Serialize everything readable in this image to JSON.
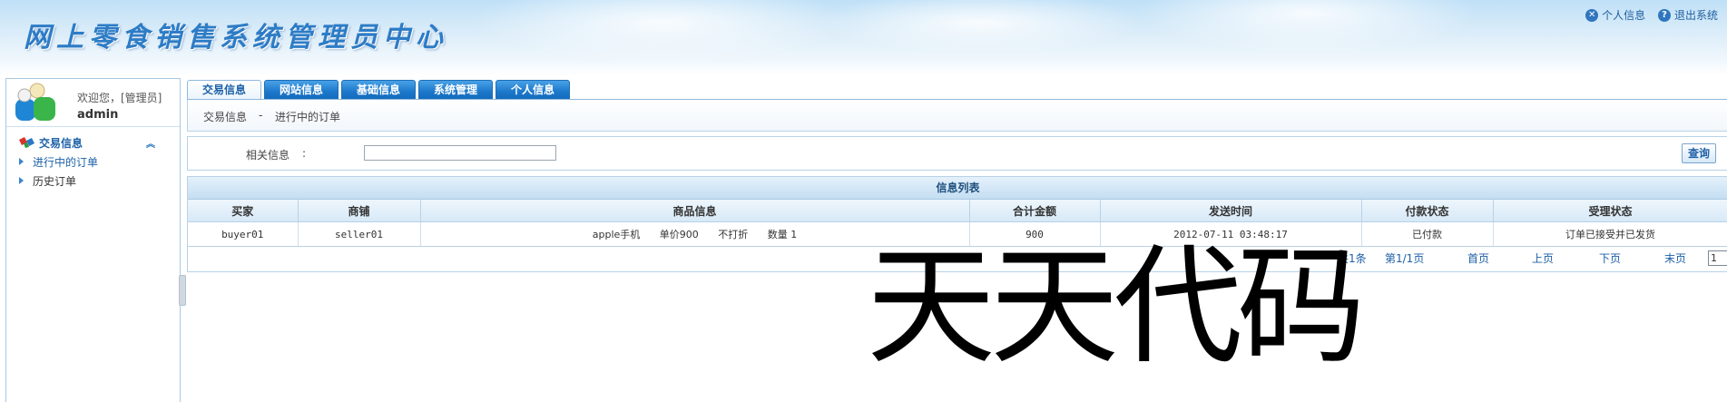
{
  "header": {
    "title": "网上零食销售系统管理员中心",
    "links": [
      {
        "label": "个人信息",
        "icon": "close-circle-icon"
      },
      {
        "label": "退出系统",
        "icon": "help-circle-icon"
      }
    ]
  },
  "user": {
    "welcome": "欢迎您，[管理员]",
    "name": "admin"
  },
  "sidebar": {
    "section": {
      "label": "交易信息",
      "collapse_icon": "double-chevron-up-icon"
    },
    "items": [
      {
        "label": "进行中的订单",
        "active": true
      },
      {
        "label": "历史订单",
        "active": false
      }
    ]
  },
  "tabs": [
    {
      "label": "交易信息",
      "active": true
    },
    {
      "label": "网站信息",
      "active": false
    },
    {
      "label": "基础信息",
      "active": false
    },
    {
      "label": "系统管理",
      "active": false
    },
    {
      "label": "个人信息",
      "active": false
    }
  ],
  "breadcrumb": {
    "section": "交易信息",
    "separator": "-",
    "page": "进行中的订单"
  },
  "search": {
    "label": "相关信息",
    "colon": ":",
    "value": "",
    "button": "查询"
  },
  "table": {
    "title": "信息列表",
    "columns": [
      "买家",
      "商铺",
      "商品信息",
      "合计金额",
      "发送时间",
      "付款状态",
      "受理状态"
    ],
    "rows": [
      {
        "buyer": "buyer01",
        "shop": "seller01",
        "goods": {
          "name": "apple手机",
          "price": "单价900",
          "discount": "不打折",
          "qty": "数量 1"
        },
        "total": "900",
        "time": "2012-07-11 03:48:17",
        "pay_status": "已付款",
        "handle_status": "订单已接受并已发货"
      }
    ]
  },
  "pager": {
    "total": "共1条",
    "page": "第1/1页",
    "first": "首页",
    "prev": "上页",
    "next": "下页",
    "last": "末页",
    "select_value": "1"
  },
  "watermark": "天天代码",
  "colors": {
    "accent": "#1d78cb",
    "title": "#2d7cc6",
    "link": "#1d5fa5",
    "nav_active": "#1d62a8"
  }
}
